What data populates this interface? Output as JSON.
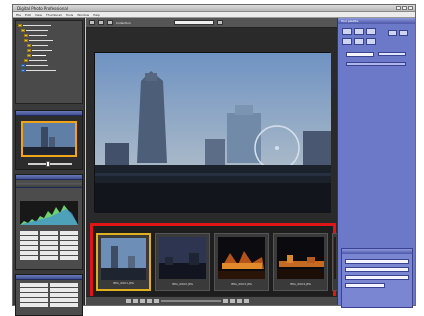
{
  "window": {
    "title": "Digital Photo Professional"
  },
  "menu": [
    "File",
    "Edit",
    "View",
    "Thumbnail",
    "Tools",
    "Window",
    "Help"
  ],
  "toolbar": {
    "label": "Collection"
  },
  "right_panel": {
    "title": "Tool palette"
  },
  "filmstrip": {
    "items": [
      {
        "name": "IMG_0001.JPG",
        "scene": "day",
        "selected": true
      },
      {
        "name": "IMG_0002.JPG",
        "scene": "dusk",
        "selected": false
      },
      {
        "name": "IMG_0003.JPG",
        "scene": "night",
        "selected": false
      },
      {
        "name": "IMG_0004.JPG",
        "scene": "night2",
        "selected": false
      },
      {
        "name": "",
        "scene": "partial",
        "selected": false
      }
    ]
  },
  "colors": {
    "highlight_frame": "#e01515",
    "selection": "#e0b020",
    "palette_bg": "#6c78c8"
  }
}
